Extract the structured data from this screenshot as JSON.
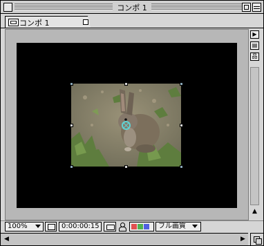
{
  "window": {
    "title": "コンポ 1"
  },
  "tab": {
    "label": "コンポ 1"
  },
  "statusbar": {
    "zoom": "100%",
    "timecode": "0:00:00:15",
    "quality": "フル画質"
  },
  "icons": {
    "close": "close-box-icon",
    "zoom": "zoom-box-icon",
    "collapse": "collapse-box-icon",
    "comp": "composition-icon",
    "region": "region-of-interest-icon",
    "camera": "snapshot-camera-icon",
    "person": "show-snapshot-icon",
    "channels": "rgb-channels-icon"
  },
  "colors": {
    "comp_background": "#000000",
    "viewer_background": "#b7b7b7",
    "anchor": "#5fd3d3"
  }
}
